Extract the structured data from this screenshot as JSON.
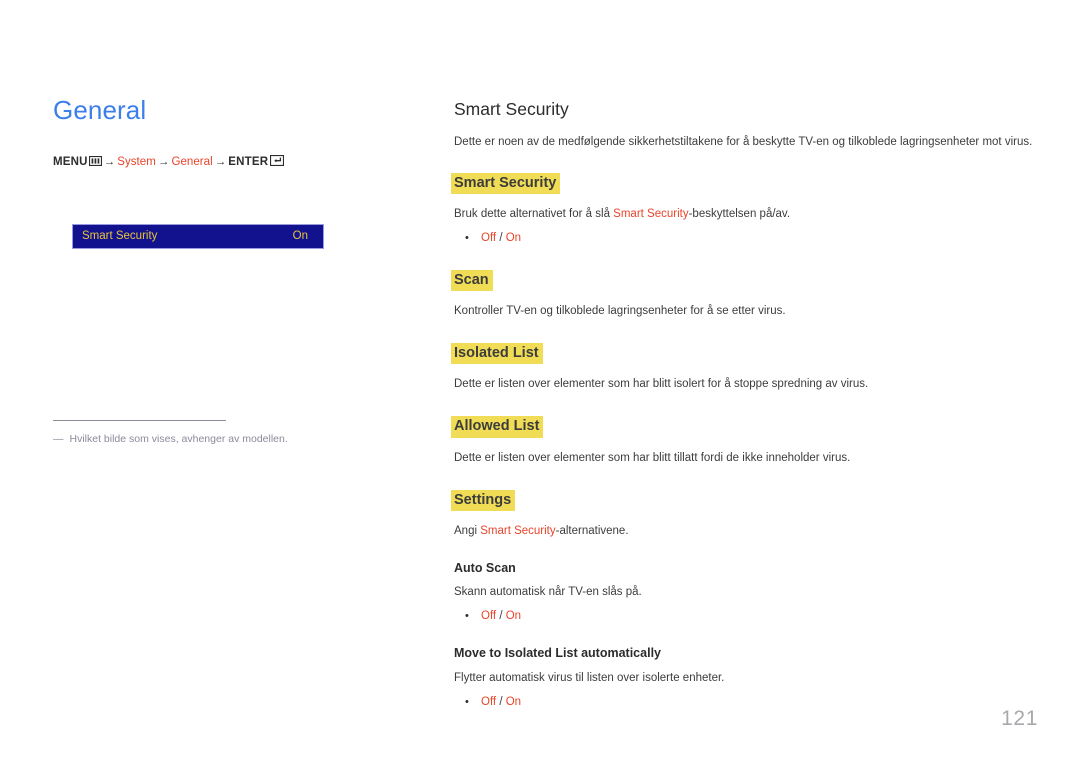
{
  "page": {
    "title": "General",
    "number": "121",
    "title_color": "#3d7fe8",
    "accent_color": "#e8442a",
    "highlight_color": "#f0dd55",
    "osd_bg_color": "#12128f",
    "osd_text_color": "#e8c53c"
  },
  "breadcrumb": {
    "menu_label": "MENU",
    "menu_icon": "menu-bars-icon",
    "arrow": "→",
    "item1": "System",
    "item2": "General",
    "enter_label": "ENTER",
    "enter_icon": "enter-return-icon"
  },
  "osd": {
    "label": "Smart Security",
    "value": "On"
  },
  "footnote": {
    "dash": "―",
    "text": "Hvilket bilde som vises, avhenger av modellen."
  },
  "main": {
    "heading": "Smart Security",
    "intro": "Dette er noen av de medfølgende sikkerhetstiltakene for å beskytte TV-en og tilkoblede lagringsenheter mot virus.",
    "sections": [
      {
        "heading": "Smart Security",
        "body_pre": "Bruk dette alternativet for å slå ",
        "body_kw": "Smart Security",
        "body_post": "-beskyttelsen på/av.",
        "options_off": "Off",
        "options_sep": " / ",
        "options_on": "On"
      },
      {
        "heading": "Scan",
        "body_pre": "Kontroller TV-en og tilkoblede lagringsenheter for å se etter virus.",
        "body_kw": "",
        "body_post": ""
      },
      {
        "heading": "Isolated List",
        "body_pre": "Dette er listen over elementer som har blitt isolert for å stoppe spredning av virus.",
        "body_kw": "",
        "body_post": ""
      },
      {
        "heading": "Allowed List",
        "body_pre": "Dette er listen over elementer som har blitt tillatt fordi de ikke inneholder virus.",
        "body_kw": "",
        "body_post": ""
      }
    ],
    "settings": {
      "heading": "Settings",
      "body_pre": "Angi ",
      "body_kw": "Smart Security",
      "body_post": "-alternativene.",
      "subsections": [
        {
          "heading": "Auto Scan",
          "body": "Skann automatisk når TV-en slås på.",
          "options_off": "Off",
          "options_sep": " / ",
          "options_on": "On"
        },
        {
          "heading": "Move to Isolated List automatically",
          "body": "Flytter automatisk virus til listen over isolerte enheter.",
          "options_off": "Off",
          "options_sep": " / ",
          "options_on": "On"
        }
      ]
    }
  }
}
